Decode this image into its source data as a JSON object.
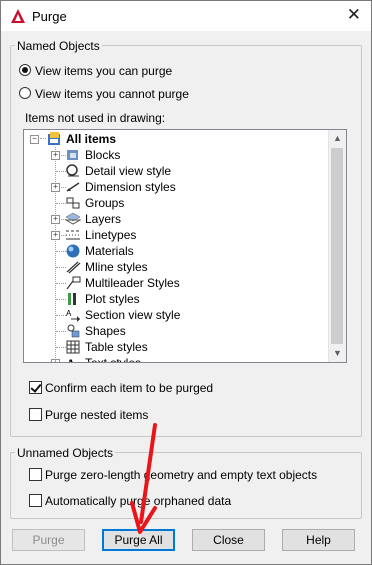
{
  "window": {
    "title": "Purge",
    "close_symbol": "✕"
  },
  "named_objects": {
    "group_label": "Named Objects",
    "radio_can_purge": "View items you can purge",
    "radio_cannot_purge": "View items you cannot purge",
    "tree_label": "Items not used in drawing:",
    "tree": {
      "root": "All items",
      "items": [
        {
          "label": "Blocks",
          "expandable": true,
          "icon": "blocks-icon"
        },
        {
          "label": "Detail view style",
          "expandable": false,
          "icon": "detail-view-style-icon"
        },
        {
          "label": "Dimension styles",
          "expandable": true,
          "icon": "dimension-styles-icon"
        },
        {
          "label": "Groups",
          "expandable": false,
          "icon": "groups-icon"
        },
        {
          "label": "Layers",
          "expandable": true,
          "icon": "layers-icon"
        },
        {
          "label": "Linetypes",
          "expandable": true,
          "icon": "linetypes-icon"
        },
        {
          "label": "Materials",
          "expandable": false,
          "icon": "materials-icon"
        },
        {
          "label": "Mline styles",
          "expandable": false,
          "icon": "mline-styles-icon"
        },
        {
          "label": "Multileader Styles",
          "expandable": false,
          "icon": "multileader-styles-icon"
        },
        {
          "label": "Plot styles",
          "expandable": false,
          "icon": "plot-styles-icon"
        },
        {
          "label": "Section view style",
          "expandable": false,
          "icon": "section-view-style-icon"
        },
        {
          "label": "Shapes",
          "expandable": false,
          "icon": "shapes-icon"
        },
        {
          "label": "Table styles",
          "expandable": false,
          "icon": "table-styles-icon"
        },
        {
          "label": "Text styles",
          "expandable": true,
          "icon": "text-styles-icon"
        }
      ]
    },
    "confirm_each": "Confirm each item to be purged",
    "confirm_each_checked": true,
    "purge_nested": "Purge nested items",
    "purge_nested_checked": false
  },
  "unnamed_objects": {
    "group_label": "Unnamed Objects",
    "zero_length": "Purge zero-length geometry and empty text objects",
    "zero_length_checked": false,
    "orphaned": "Automatically purge orphaned data",
    "orphaned_checked": false
  },
  "buttons": {
    "purge": "Purge",
    "purge_all": "Purge All",
    "close": "Close",
    "help": "Help"
  },
  "colors": {
    "accent": "#0078d7",
    "annotation_arrow": "#e8161b",
    "app_icon": "#c8102e"
  }
}
